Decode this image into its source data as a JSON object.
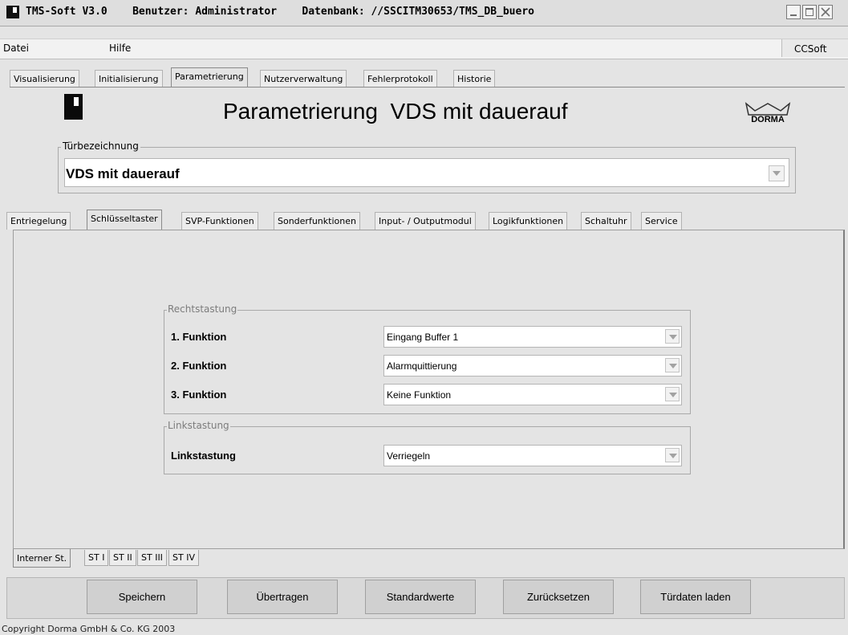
{
  "window": {
    "title_app": "TMS-Soft V3.0",
    "title_user": "Benutzer: Administrator",
    "title_db": "Datenbank: //SSCITM30653/TMS_DB_buero"
  },
  "menu": {
    "file": "Datei",
    "help": "Hilfe",
    "right": "CCSoft"
  },
  "main_tabs": [
    "Visualisierung",
    "Initialisierung",
    "Parametrierung",
    "Nutzerverwaltung",
    "Fehlerprotokoll",
    "Historie"
  ],
  "header": {
    "title": "Parametrierung  VDS mit dauerauf",
    "brand": "DORMA"
  },
  "door": {
    "legend": "Türbezeichnung",
    "value": "VDS mit dauerauf"
  },
  "sub_tabs": [
    "Entriegelung",
    "Schlüsseltaster",
    "SVP-Funktionen",
    "Sonderfunktionen",
    "Input- / Outputmodul",
    "Logikfunktionen",
    "Schaltuhr",
    "Service"
  ],
  "right_group": {
    "legend": "Rechtstastung",
    "rows": [
      {
        "label": "1. Funktion",
        "value": "Eingang Buffer 1"
      },
      {
        "label": "2. Funktion",
        "value": "Alarmquittierung"
      },
      {
        "label": "3. Funktion",
        "value": "Keine Funktion"
      }
    ]
  },
  "left_group": {
    "legend": "Linkstastung",
    "label": "Linkstastung",
    "value": "Verriegeln"
  },
  "bottom_tabs": [
    "Interner St.",
    "ST I",
    "ST II",
    "ST III",
    "ST IV"
  ],
  "buttons": [
    "Speichern",
    "Übertragen",
    "Standardwerte",
    "Zurücksetzen",
    "Türdaten laden"
  ],
  "footer": "Copyright Dorma GmbH & Co. KG 2003"
}
